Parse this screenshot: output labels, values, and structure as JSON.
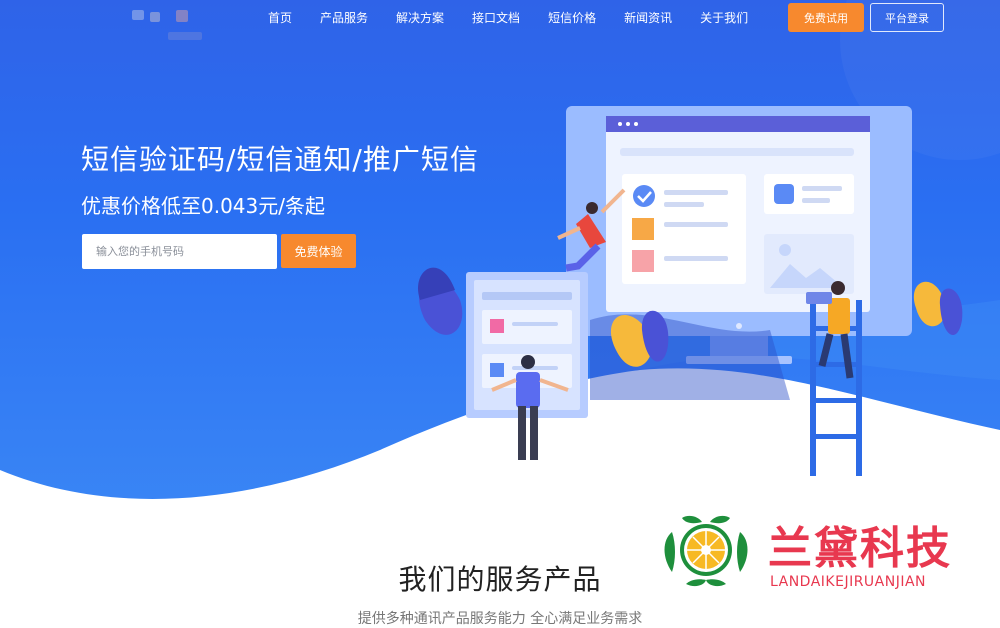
{
  "nav": {
    "items": [
      {
        "label": "首页"
      },
      {
        "label": "产品服务"
      },
      {
        "label": "解决方案"
      },
      {
        "label": "接口文档"
      },
      {
        "label": "短信价格"
      },
      {
        "label": "新闻资讯"
      },
      {
        "label": "关于我们"
      }
    ],
    "trial_button": "免费试用",
    "login_button": "平台登录"
  },
  "hero": {
    "headline": "短信验证码/短信通知/推广短信",
    "subline": "优惠价格低至0.043元/条起",
    "phone_placeholder": "输入您的手机号码",
    "phone_value": "",
    "submit_button": "免费体验"
  },
  "section": {
    "title": "我们的服务产品",
    "subtitle": "提供多种通讯产品服务能力 全心满足业务需求"
  },
  "watermark": {
    "name_cn": "兰黛科技",
    "name_en": "LANDAIKEJIRUANJIAN"
  },
  "colors": {
    "hero_blue": "#2f63e8",
    "accent_orange": "#f7892e",
    "watermark_red": "#e8384f"
  }
}
